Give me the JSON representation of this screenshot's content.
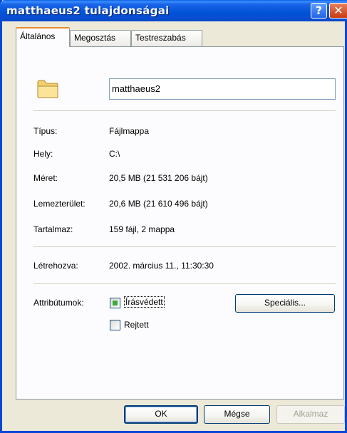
{
  "window": {
    "title": "matthaeus2 tulajdonságai",
    "help_glyph": "?",
    "close_glyph": "✕"
  },
  "tabs": [
    {
      "label": "Általános",
      "active": true
    },
    {
      "label": "Megosztás",
      "active": false
    },
    {
      "label": "Testreszabás",
      "active": false
    }
  ],
  "general": {
    "folder_icon": "folder-icon",
    "name_value": "matthaeus2",
    "type_label": "Típus:",
    "type_value": "Fájlmappa",
    "location_label": "Hely:",
    "location_value": "C:\\",
    "size_label": "Méret:",
    "size_value": "20,5 MB (21 531 206 bájt)",
    "disk_label": "Lemezterület:",
    "disk_value": "20,6 MB (21 610 496 bájt)",
    "contains_label": "Tartalmaz:",
    "contains_value": "159 fájl, 2 mappa",
    "created_label": "Létrehozva:",
    "created_value": "2002. március 11., 11:30:30",
    "attributes_label": "Attribútumok:",
    "readonly_label": "Írásvédett",
    "readonly_state": "indeterminate",
    "hidden_label": "Rejtett",
    "hidden_state": "unchecked",
    "advanced_button": "Speciális..."
  },
  "footer": {
    "ok": "OK",
    "cancel": "Mégse",
    "apply": "Alkalmaz"
  },
  "colors": {
    "titlebar": "#0a4ccf",
    "active_tab_accent": "#e68b2c",
    "checkbox_fill": "#3aab3a"
  }
}
